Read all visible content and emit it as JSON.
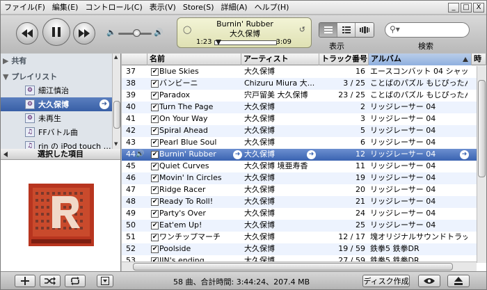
{
  "menu": [
    "ファイル(F)",
    "編集(E)",
    "コントロール(C)",
    "表示(V)",
    "Store(S)",
    "詳細(A)",
    "ヘルプ(H)"
  ],
  "window_buttons": {
    "minimize": "_",
    "maximize": "□",
    "close": "X"
  },
  "toolbar": {
    "prev_icon": "rewind-icon",
    "play_icon": "pause-icon",
    "next_icon": "fast-forward-icon"
  },
  "lcd": {
    "title": "Burnin' Rubber",
    "artist": "大久保博",
    "elapsed": "1:23",
    "remaining": "3:09",
    "progress": 0.07
  },
  "view": {
    "label": "表示"
  },
  "search": {
    "label": "検索",
    "value": ""
  },
  "sidebar": {
    "sections": [
      {
        "label": "共有"
      },
      {
        "label": "プレイリスト"
      }
    ],
    "items": [
      {
        "label": "細江慎治",
        "icon": "smart-playlist-icon"
      },
      {
        "label": "大久保博",
        "icon": "smart-playlist-icon",
        "selected": true
      },
      {
        "label": "未再生",
        "icon": "smart-playlist-icon"
      },
      {
        "label": "FFバトル曲",
        "icon": "playlist-icon"
      },
      {
        "label": "rin の iPod touch …",
        "icon": "playlist-icon"
      }
    ]
  },
  "artwork_panel": {
    "title": "選択した項目"
  },
  "columns": [
    "名前",
    "アーティスト",
    "トラック番号",
    "アルバム",
    "時"
  ],
  "tracks": [
    {
      "num": "37",
      "name": "Blue Skies",
      "artist": "大久保博",
      "track": "16",
      "album": "エースコンバット 04 シャッタ..."
    },
    {
      "num": "38",
      "name": "バンビーニ",
      "artist": "Chizuru Miura  大...",
      "track": "3 / 25",
      "album": "ことばのパズル もじぴったん..."
    },
    {
      "num": "39",
      "name": "Paradox",
      "artist": "宍戸留美  大久保博",
      "track": "23 / 25",
      "album": "ことばのパズル もじぴったん..."
    },
    {
      "num": "40",
      "name": "Turn The Page",
      "artist": "大久保博",
      "track": "2",
      "album": "リッジレーサー 04"
    },
    {
      "num": "41",
      "name": "On Your Way",
      "artist": "大久保博",
      "track": "3",
      "album": "リッジレーサー 04"
    },
    {
      "num": "42",
      "name": "Spiral Ahead",
      "artist": "大久保博",
      "track": "5",
      "album": "リッジレーサー 04"
    },
    {
      "num": "43",
      "name": "Pearl Blue Soul",
      "artist": "大久保博",
      "track": "6",
      "album": "リッジレーサー 04"
    },
    {
      "num": "44",
      "name": "Burnin' Rubber",
      "artist": "大久保博",
      "track": "12",
      "album": "リッジレーサー 04",
      "playing": true
    },
    {
      "num": "45",
      "name": "Quiet Curves",
      "artist": "大久保博  境亜寿香",
      "track": "11",
      "album": "リッジレーサー 04"
    },
    {
      "num": "46",
      "name": "Movin' In Circles",
      "artist": "大久保博",
      "track": "19",
      "album": "リッジレーサー 04"
    },
    {
      "num": "47",
      "name": "Ridge Racer",
      "artist": "大久保博",
      "track": "20",
      "album": "リッジレーサー 04"
    },
    {
      "num": "48",
      "name": "Ready To Roll!",
      "artist": "大久保博",
      "track": "21",
      "album": "リッジレーサー 04"
    },
    {
      "num": "49",
      "name": "Party's Over",
      "artist": "大久保博",
      "track": "24",
      "album": "リッジレーサー 04"
    },
    {
      "num": "50",
      "name": "Eat'em Up!",
      "artist": "大久保博",
      "track": "25",
      "album": "リッジレーサー 04"
    },
    {
      "num": "51",
      "name": "ワンチップマーチ",
      "artist": "大久保博",
      "track": "12 / 17",
      "album": "塊オリジナルサウンドトラッ..."
    },
    {
      "num": "52",
      "name": "Poolside",
      "artist": "大久保博",
      "track": "19 / 59",
      "album": "鉄拳5 鉄拳DR"
    },
    {
      "num": "53",
      "name": "JIN's ending",
      "artist": "大久保博",
      "track": "27 / 59",
      "album": "鉄拳5 鉄拳DR"
    }
  ],
  "status": {
    "text": "58 曲、合計時間: 3:44:24、207.4 MB",
    "burn_label": "ディスク作成"
  },
  "colors": {
    "selection": "#3a63b1",
    "lcd_bg": "#e8e9c3",
    "row_alt": "#edf3fe"
  }
}
